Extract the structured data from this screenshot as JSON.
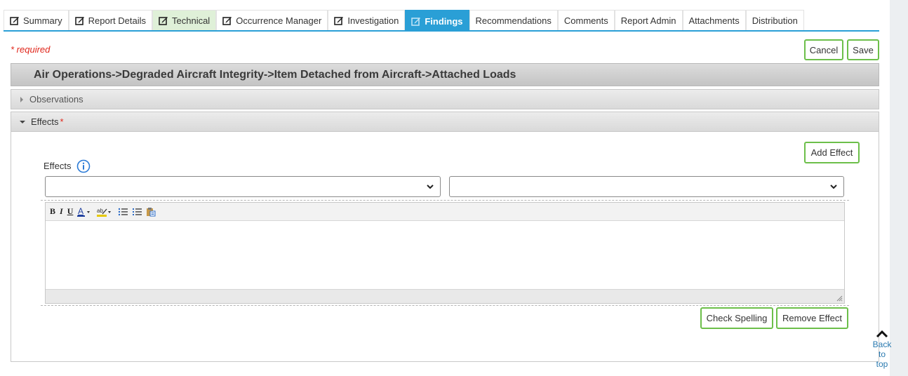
{
  "tabs": [
    {
      "label": "Summary",
      "icon": "edit-icon",
      "state": "normal"
    },
    {
      "label": "Report Details",
      "icon": "edit-icon",
      "state": "normal"
    },
    {
      "label": "Technical",
      "icon": "edit-icon",
      "state": "highlighted"
    },
    {
      "label": "Occurrence Manager",
      "icon": "edit-icon",
      "state": "normal"
    },
    {
      "label": "Investigation",
      "icon": "edit-icon",
      "state": "normal"
    },
    {
      "label": "Findings",
      "icon": "edit-icon",
      "state": "active"
    },
    {
      "label": "Recommendations",
      "state": "normal"
    },
    {
      "label": "Comments",
      "state": "normal"
    },
    {
      "label": "Report Admin",
      "state": "normal"
    },
    {
      "label": "Attachments",
      "state": "normal"
    },
    {
      "label": "Distribution",
      "state": "normal"
    }
  ],
  "form": {
    "required_note": "* required",
    "cancel_label": "Cancel",
    "save_label": "Save"
  },
  "banner": {
    "title": "Air Operations->Degraded Aircraft Integrity->Item Detached from Aircraft->Attached Loads"
  },
  "observations": {
    "label": "Observations",
    "expanded": false
  },
  "effects_section": {
    "label": "Effects",
    "required_mark": "*",
    "expanded": true,
    "add_effect_label": "Add Effect",
    "field_label": "Effects",
    "select_1_value": "",
    "select_2_value": "",
    "editor_text": "",
    "editor_toolbar": [
      "bold",
      "italic",
      "underline",
      "font-color",
      "highlight-color",
      "bullet-list",
      "numbered-list",
      "paste-from-word"
    ],
    "check_spelling_label": "Check Spelling",
    "remove_effect_label": "Remove Effect"
  },
  "back_to_top": {
    "line1": "Back to",
    "line2": "top"
  },
  "colors": {
    "accent": "#2a9fd6",
    "button_border": "#6cbf4a",
    "required": "#e0261b",
    "technical_tab": "#dff0d8"
  }
}
